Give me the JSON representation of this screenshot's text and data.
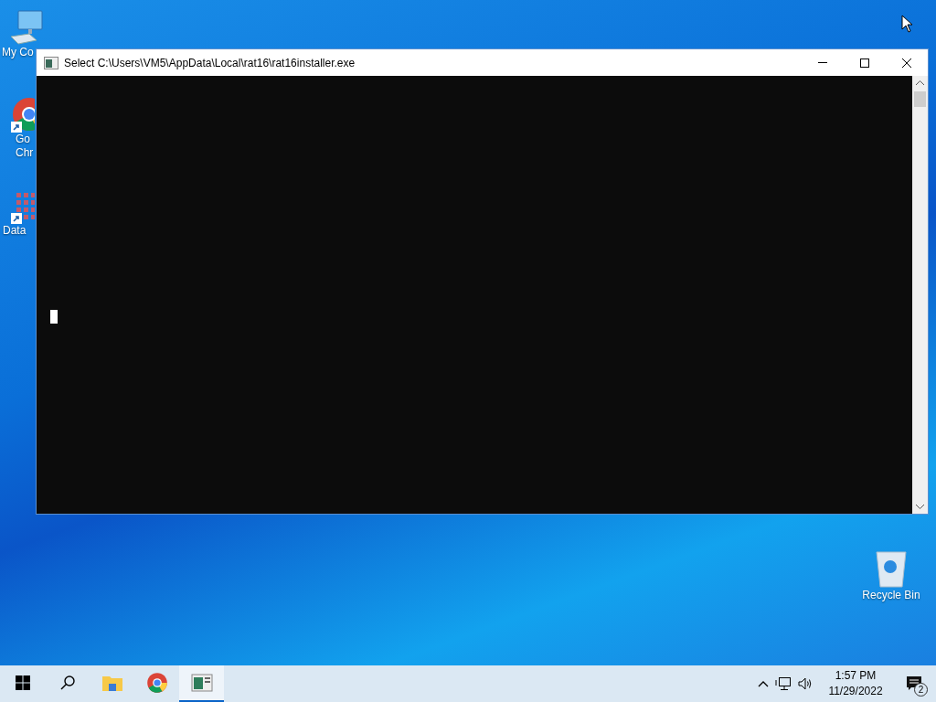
{
  "desktop_icons": [
    {
      "kind": "computer",
      "lines": [
        "My Co"
      ],
      "shortcut": false
    },
    {
      "kind": "chrome",
      "lines": [
        "Go",
        "Chr"
      ],
      "shortcut": true
    },
    {
      "kind": "grid",
      "lines": [
        "Data"
      ],
      "shortcut": true
    },
    {
      "kind": "recycle",
      "lines": [
        "Recycle Bin"
      ],
      "shortcut": false
    }
  ],
  "window": {
    "title": "Select C:\\Users\\VM5\\AppData\\Local\\rat16\\rat16installer.exe"
  },
  "taskbar": {
    "apps": [
      {
        "kind": "start",
        "selected": false
      },
      {
        "kind": "search",
        "selected": false
      },
      {
        "kind": "explorer",
        "selected": false
      },
      {
        "kind": "chrome",
        "selected": false
      },
      {
        "kind": "console",
        "selected": true
      }
    ],
    "tray": {
      "time": "1:57 PM",
      "date": "11/29/2022",
      "notifications": "2"
    }
  }
}
